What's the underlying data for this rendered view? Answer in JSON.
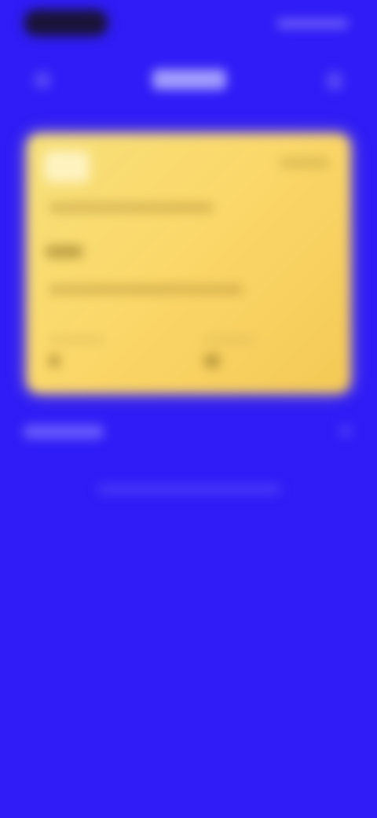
{
  "status_bar": {},
  "nav": {},
  "card": {},
  "section": {},
  "hint": {},
  "colors": {
    "background": "#2f1cf6",
    "card_gradient_start": "#f6e07a",
    "card_gradient_end": "#f4c955"
  },
  "icons": {
    "back": "chevron-left-icon",
    "action": "more-icon",
    "section_chevron": "chevron-right-icon"
  }
}
